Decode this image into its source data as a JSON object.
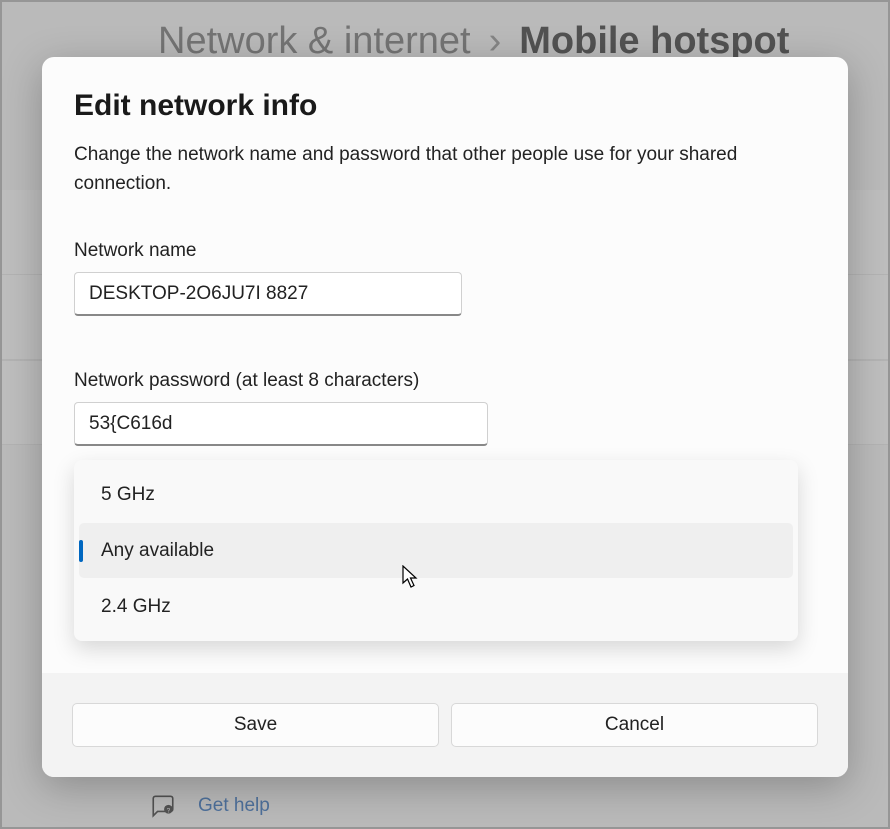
{
  "breadcrumb": {
    "parent": "Network & internet",
    "separator": "›",
    "current": "Mobile hotspot"
  },
  "dialog": {
    "title": "Edit network info",
    "description": "Change the network name and password that other people use for your shared connection.",
    "name_label": "Network name",
    "name_value": "DESKTOP-2O6JU7I 8827",
    "password_label": "Network password (at least 8 characters)",
    "password_value": "53{C616d",
    "options": [
      {
        "label": "5 GHz",
        "selected": false
      },
      {
        "label": "Any available",
        "selected": true
      },
      {
        "label": "2.4 GHz",
        "selected": false
      }
    ],
    "save_label": "Save",
    "cancel_label": "Cancel"
  },
  "help": {
    "link_text": "Get help"
  }
}
